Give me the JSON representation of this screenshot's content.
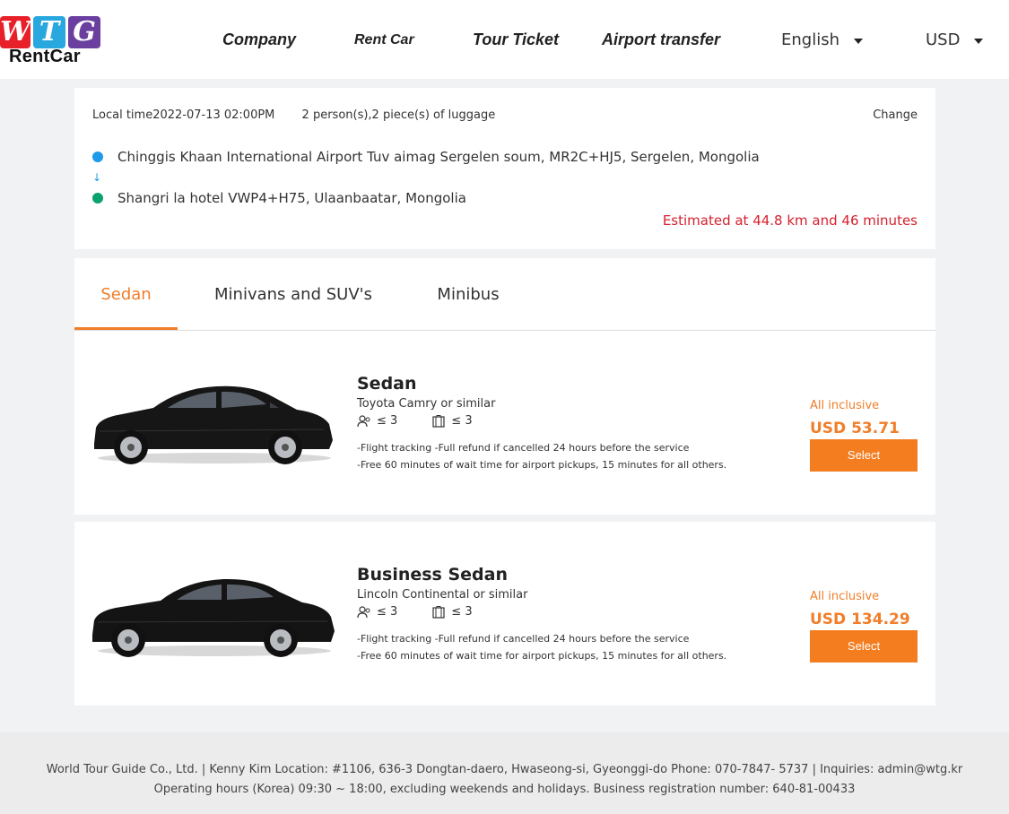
{
  "header": {
    "logo": {
      "letters": [
        "W",
        "T",
        "G"
      ],
      "sub": "RentCar",
      "colors": [
        "#e8202a",
        "#29a8e0",
        "#6b3fa0"
      ]
    },
    "nav": [
      {
        "label": "Company"
      },
      {
        "label": "Rent Car"
      },
      {
        "label": "Tour Ticket"
      },
      {
        "label": "Airport transfer"
      }
    ],
    "language": "English",
    "currency": "USD"
  },
  "trip": {
    "local_time": "Local time2022-07-13 02:00PM",
    "passengers": "2 person(s),2 piece(s) of luggage",
    "change_label": "Change",
    "from": "Chinggis Khaan International Airport Tuv aimag Sergelen soum, MR2C+HJ5, Sergelen, Mongolia",
    "to": "Shangri la hotel VWP4+H75, Ulaanbaatar, Mongolia",
    "arrow": "↓",
    "estimate": "Estimated at 44.8 km and 46 minutes"
  },
  "tabs": [
    {
      "label": "Sedan",
      "active": true
    },
    {
      "label": "Minivans and SUV's",
      "active": false
    },
    {
      "label": "Minibus",
      "active": false
    }
  ],
  "cars": [
    {
      "name": "Sedan",
      "model": "Toyota Camry or similar",
      "passengers": "≤  3",
      "luggage": "≤  3",
      "features": [
        "-Flight tracking -Full refund if cancelled 24 hours before the service",
        "-Free 60 minutes of wait time for airport pickups, 15 minutes for all others."
      ],
      "inclusive": "All inclusive",
      "price": "USD 53.71",
      "button": "Select"
    },
    {
      "name": "Business Sedan",
      "model": "Lincoln Continental or similar",
      "passengers": "≤  3",
      "luggage": "≤  3",
      "features": [
        "-Flight tracking -Full refund if cancelled 24 hours before the service",
        "-Free 60 minutes of wait time for airport pickups, 15 minutes for all others."
      ],
      "inclusive": "All inclusive",
      "price": "USD 134.29",
      "button": "Select"
    }
  ],
  "footer": {
    "text": "World Tour Guide Co., Ltd. | Kenny Kim Location: #1106, 636-3 Dongtan-daero, Hwaseong-si, Gyeonggi-do Phone: 070-7847- 5737 | Inquiries: admin@wtg.kr Operating hours (Korea) 09:30 ~ 18:00, excluding weekends and holidays. Business registration number: 640-81-00433"
  },
  "colors": {
    "accent": "#f47d20",
    "estimate": "#d6202d",
    "origin_dot": "#1e9ae8",
    "destination_dot": "#0aa36f"
  }
}
